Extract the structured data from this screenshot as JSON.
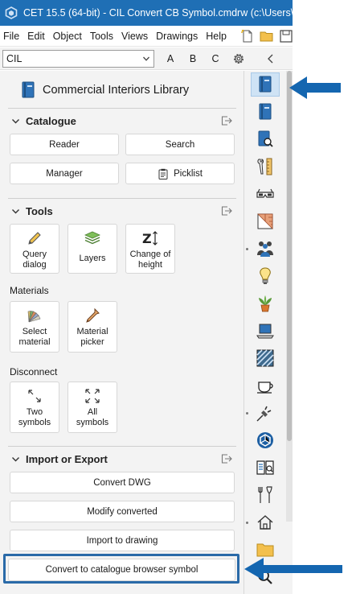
{
  "window": {
    "title": "CET 15.5 (64-bit) - CIL Convert CB Symbol.cmdrw (c:\\Users\\julh"
  },
  "menu": {
    "items": [
      "File",
      "Edit",
      "Object",
      "Tools",
      "Views",
      "Drawings",
      "Help"
    ]
  },
  "selector": {
    "value": "CIL",
    "letters": [
      "A",
      "B",
      "C"
    ]
  },
  "library": {
    "title": "Commercial Interiors Library"
  },
  "catalogue": {
    "heading": "Catalogue",
    "reader": "Reader",
    "search": "Search",
    "manager": "Manager",
    "picklist": "Picklist"
  },
  "tools": {
    "heading": "Tools",
    "query": "Query dialog",
    "layers": "Layers",
    "height": "Change of height"
  },
  "materials": {
    "heading": "Materials",
    "select": "Select material",
    "picker": "Material picker"
  },
  "disconnect": {
    "heading": "Disconnect",
    "two": "Two symbols",
    "all": "All symbols"
  },
  "import_export": {
    "heading": "Import or Export",
    "convert_dwg": "Convert DWG",
    "modify": "Modify converted",
    "import": "Import to drawing",
    "convert_cb": "Convert to catalogue browser symbol"
  },
  "colors": {
    "titlebar": "#1f6fb5",
    "highlight": "#2a6aa8",
    "arrow": "#1466b0",
    "panel": "#f3f3f3"
  }
}
